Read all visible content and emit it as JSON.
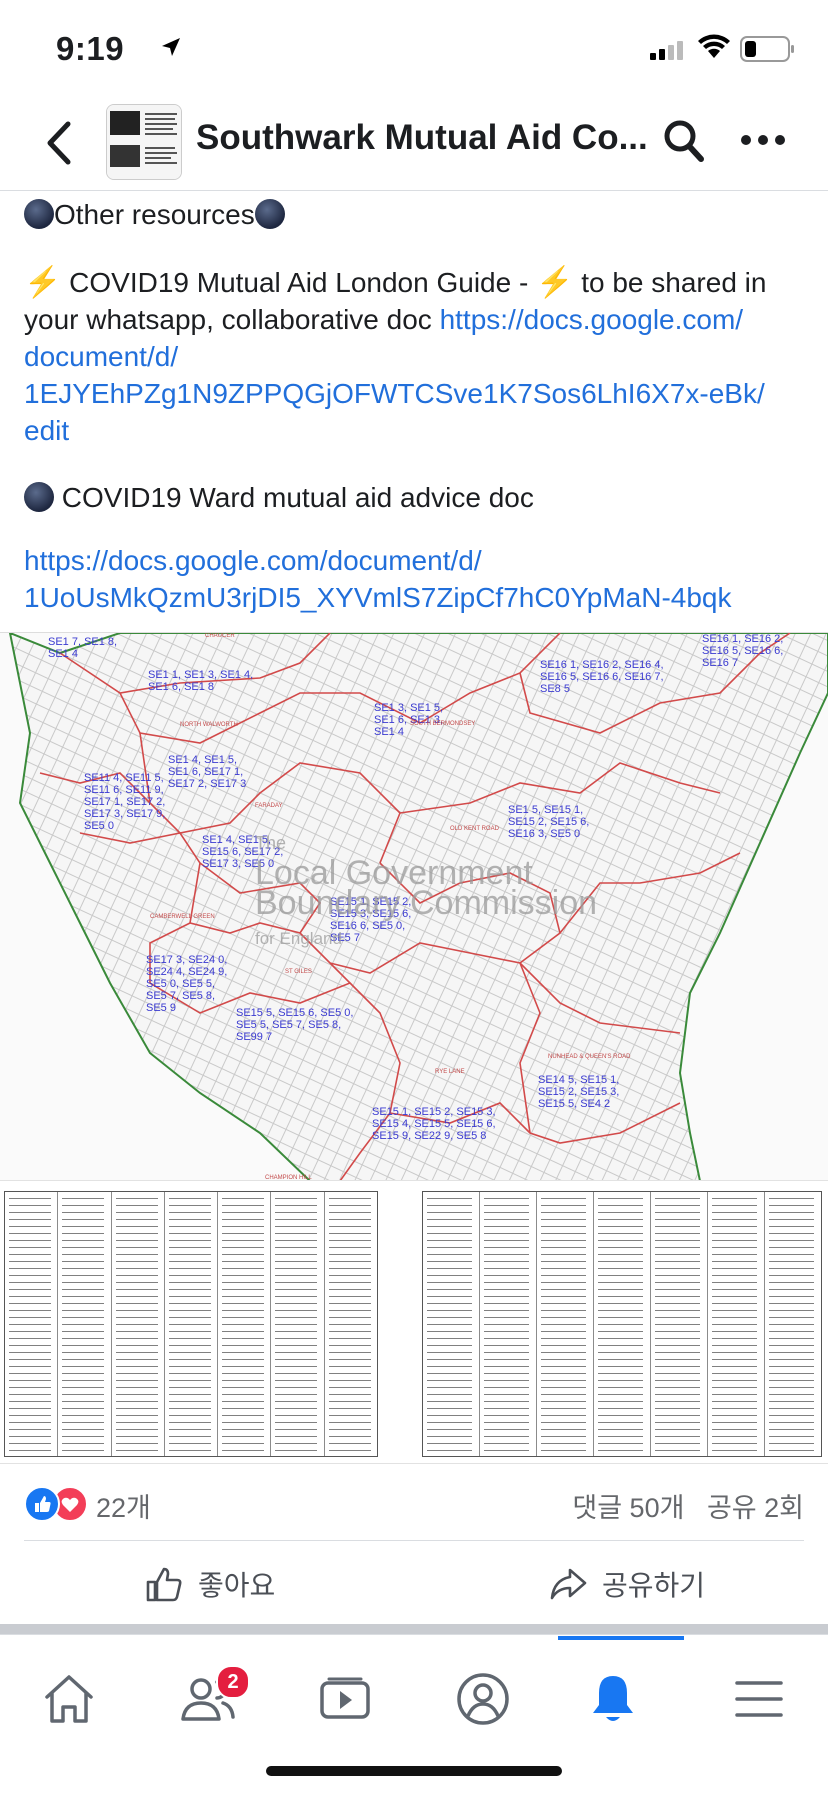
{
  "status_bar": {
    "time": "9:19"
  },
  "header": {
    "group_title": "Southwark Mutual Aid Co..."
  },
  "post": {
    "other_resources": "Other resources",
    "guide_prefix": "COVID19 Mutual Aid London Guide - ",
    "guide_suffix": " to be shared in",
    "guide_line2_text": "your whatsapp, collaborative doc ",
    "guide_link_part1": "https://docs.google.com/",
    "guide_link_part2": "document/d/",
    "guide_link_part3": "1EJYEhPZg1N9ZPPQGjOFWTCSve1K7Sos6LhI6X7x-eBk/",
    "guide_link_part4": "edit",
    "ward_doc": "COVID19 Ward mutual aid advice doc",
    "ward_link_part1": "https://docs.google.com/document/d/",
    "ward_link_part2": "1UoUsMkQzmU3rjDI5_XYVmlS7ZipCf7hC0YpMaN-4bqk"
  },
  "map": {
    "labels": [
      "SE1 7, SE1 8,",
      "SE1 4",
      "SE1 1, SE1 3, SE1 4,",
      "SE1 6, SE1 8",
      "SE1 3, SE1 5,",
      "SE1 6, SE1 3,",
      "SE1 4",
      "SE16 1, SE16 2, SE16 4,",
      "SE16 5, SE16 6, SE16 7,",
      "SE8 5",
      "SE16 1, SE16 2,",
      "SE16 5, SE16 6,",
      "SE16 7",
      "SE1 4, SE1 5,",
      "SE1 6, SE17 1,",
      "SE17 2, SE17 3",
      "SE11 4, SE11 5,",
      "SE11 6, SE11 9,",
      "SE17 1, SE17 2,",
      "SE17 3, SE17 9,",
      "SE5 0",
      "SE1 5, SE15 1,",
      "SE15 2, SE15 6,",
      "SE16 3, SE5 0",
      "SE1 4, SE1 5,",
      "SE15 6, SE17 2,",
      "SE17 3, SE5 0",
      "SE15 1, SE15 2,",
      "SE15 3, SE15 6,",
      "SE16 6, SE5 0,",
      "SE5 7",
      "SE17 3, SE24 0,",
      "SE24 4, SE24 9,",
      "SE5 0, SE5 5,",
      "SE5 7, SE5 8,",
      "SE5 9",
      "SE15 5, SE15 6, SE5 0,",
      "SE5 5, SE5 7, SE5 8,",
      "SE99 7",
      "SE14 5, SE15 1,",
      "SE15 2, SE15 3,",
      "SE15 5, SE4 2",
      "SE15 1, SE15 2, SE15 3,",
      "SE15 4, SE15 5, SE15 6,",
      "SE15 9, SE22 9, SE5 8"
    ],
    "roads": [
      "CHAUCER",
      "NORTH WALWORTH",
      "SOUTH BERMONDSEY",
      "FARADAY",
      "OLD KENT ROAD",
      "CAMBERWELL GREEN",
      "ST GILES",
      "NUNHEAD & QUEEN'S ROAD",
      "RYE LANE",
      "CHAMPION HILL"
    ],
    "watermark_1": "The",
    "watermark_2": "Local Government",
    "watermark_3": "Boundary Commission",
    "watermark_4": "for England"
  },
  "reactions": {
    "count": "22개",
    "comments": "댓글 50개",
    "shares": "공유 2회"
  },
  "actions": {
    "like": "좋아요",
    "share": "공유하기"
  },
  "tabbar": {
    "friends_badge": "2"
  },
  "colors": {
    "link": "#216fdb",
    "fb_blue": "#1877f2",
    "badge_red": "#e41e3f",
    "map_ward_label": "#3a3ad0",
    "map_boundary_red": "#d24a4a",
    "map_boundary_green": "#3a8a3a"
  }
}
